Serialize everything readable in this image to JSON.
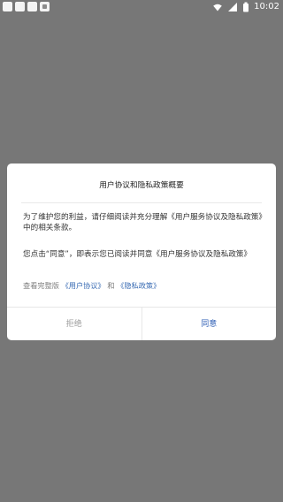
{
  "status_bar": {
    "time": "10:02",
    "icons": [
      "app-icon",
      "app-icon",
      "app-icon",
      "media-icon",
      "wifi-icon",
      "signal-icon",
      "battery-icon"
    ]
  },
  "dialog": {
    "title": "用户协议和隐私政策概要",
    "paragraph_1": "为了维护您的利益，请仔细阅读并充分理解《用户服务协议及隐私政策》中的相关条款。",
    "paragraph_2": "您点击“同意”，即表示您已阅读并同意《用户服务协议及隐私政策》",
    "links_prefix": "查看完整版",
    "link_user_agreement": "《用户协议》",
    "links_connector": "和",
    "link_privacy_policy": "《隐私政策》",
    "reject_label": "拒绝",
    "agree_label": "同意"
  },
  "colors": {
    "background": "#777777",
    "dialog_background": "#ffffff",
    "link": "#3b6db4",
    "agree_text": "#2f5fb5",
    "reject_text": "#9c9c9c"
  }
}
